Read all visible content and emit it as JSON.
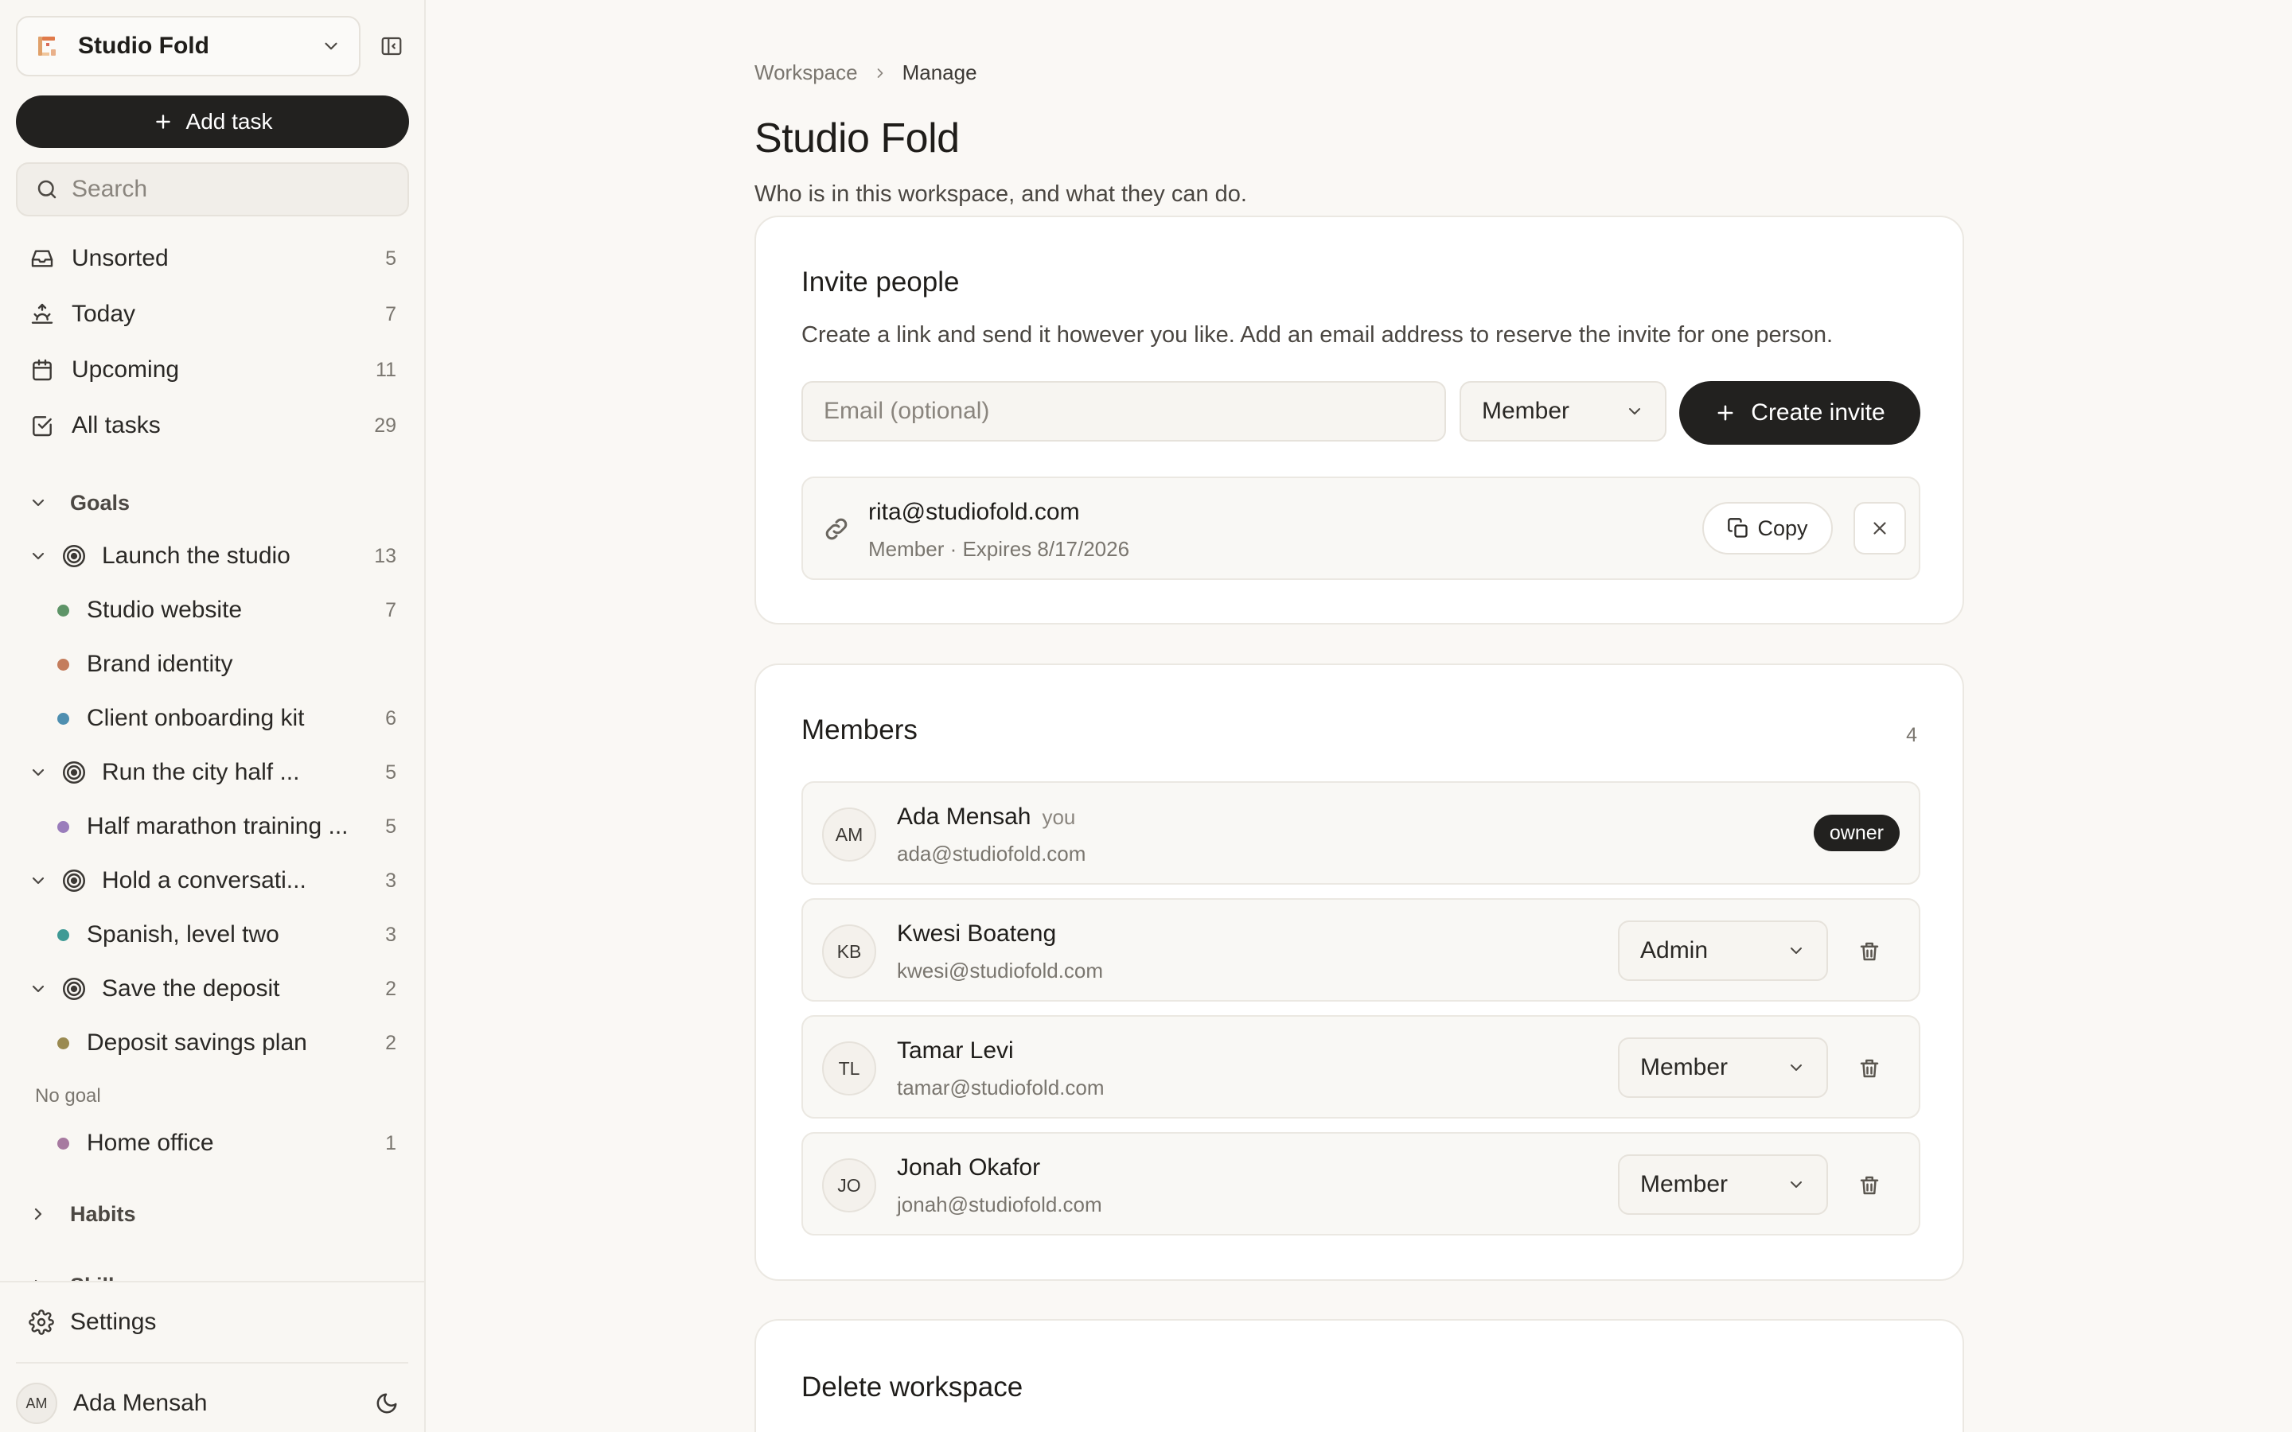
{
  "sidebar": {
    "workspace_name": "Studio Fold",
    "add_task_label": "Add task",
    "search_placeholder": "Search",
    "nav": [
      {
        "label": "Unsorted",
        "count": "5"
      },
      {
        "label": "Today",
        "count": "7"
      },
      {
        "label": "Upcoming",
        "count": "11"
      },
      {
        "label": "All tasks",
        "count": "29"
      }
    ],
    "goals_header": "Goals",
    "goals": [
      {
        "label": "Launch the studio",
        "count": "13"
      },
      {
        "label": "Run the city half ...",
        "count": "5"
      },
      {
        "label": "Hold a conversati...",
        "count": "3"
      },
      {
        "label": "Save the deposit",
        "count": "2"
      }
    ],
    "projects": [
      {
        "label": "Studio website",
        "count": "7",
        "color": "#5e9467"
      },
      {
        "label": "Brand identity",
        "count": "",
        "color": "#c47d5c"
      },
      {
        "label": "Client onboarding kit",
        "count": "6",
        "color": "#4f8fb0"
      },
      {
        "label": "Half marathon training ...",
        "count": "5",
        "color": "#9a7dbb"
      },
      {
        "label": "Spanish, level two",
        "count": "3",
        "color": "#3f9a95"
      },
      {
        "label": "Deposit savings plan",
        "count": "2",
        "color": "#9a8a50"
      },
      {
        "label": "Home office",
        "count": "1",
        "color": "#a77aa0"
      }
    ],
    "no_goal_label": "No goal",
    "habits_header": "Habits",
    "skills_header": "Skills",
    "settings_label": "Settings",
    "user": {
      "initials": "AM",
      "name": "Ada Mensah"
    }
  },
  "breadcrumb": {
    "workspace": "Workspace",
    "current": "Manage"
  },
  "page": {
    "title": "Studio Fold",
    "subtitle": "Who is in this workspace, and what they can do."
  },
  "invite": {
    "title": "Invite people",
    "description": "Create a link and send it however you like. Add an email address to reserve the invite for one person.",
    "email_placeholder": "Email (optional)",
    "role": "Member",
    "create_label": "Create invite",
    "pending": {
      "email": "rita@studiofold.com",
      "meta": "Member · Expires 8/17/2026",
      "copy_label": "Copy"
    }
  },
  "members": {
    "title": "Members",
    "count": "4",
    "you_label": "you",
    "owner_label": "owner",
    "list": [
      {
        "initials": "AM",
        "name": "Ada Mensah",
        "email": "ada@studiofold.com",
        "role": "owner"
      },
      {
        "initials": "KB",
        "name": "Kwesi Boateng",
        "email": "kwesi@studiofold.com",
        "role": "Admin"
      },
      {
        "initials": "TL",
        "name": "Tamar Levi",
        "email": "tamar@studiofold.com",
        "role": "Member"
      },
      {
        "initials": "JO",
        "name": "Jonah Okafor",
        "email": "jonah@studiofold.com",
        "role": "Member"
      }
    ]
  },
  "delete": {
    "title": "Delete workspace"
  },
  "colors": {
    "accent": "#22211f",
    "background": "#faf8f5"
  }
}
